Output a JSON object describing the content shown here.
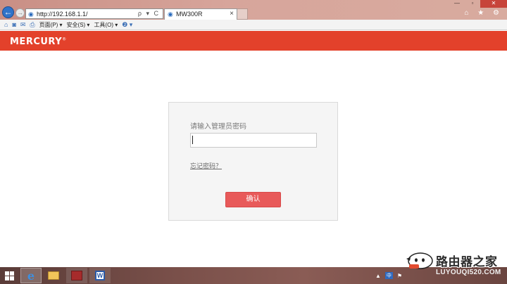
{
  "browser": {
    "address_url": "http://192.168.1.1/",
    "address_controls": "ρ ▾ C",
    "tab_title": "MW300R",
    "tab_close": "×",
    "window_controls": [
      "—",
      "▫",
      "✕"
    ],
    "toolbar_icons": "⌂ ★ ⚙"
  },
  "commandbar": {
    "items": [
      {
        "icon": "home-icon",
        "glyph": "⌂"
      },
      {
        "icon": "feeds-icon",
        "glyph": "◙"
      },
      {
        "icon": "mail-icon",
        "glyph": "✉"
      },
      {
        "icon": "print-icon",
        "glyph": "⎙"
      }
    ],
    "page_menu": "页面(P) ▾",
    "safety_menu": "安全(S) ▾",
    "tools_menu": "工具(O) ▾",
    "help_menu": "❷ ▾"
  },
  "router": {
    "brand": "MERCURY",
    "brand_mark": "®",
    "login": {
      "prompt": "请输入管理员密码",
      "password_value": "",
      "forgot_link": "忘记密码？",
      "confirm_button": "确认"
    },
    "accent_color": "#e3412b",
    "button_color": "#e85a5a"
  },
  "taskbar": {
    "apps": [
      {
        "name": "start-button",
        "icon": "windows-logo-icon"
      },
      {
        "name": "internet-explorer",
        "icon": "ie-icon",
        "glyph": "e"
      },
      {
        "name": "file-explorer",
        "icon": "folder-icon"
      },
      {
        "name": "app-red",
        "icon": "red-app-icon"
      },
      {
        "name": "word",
        "icon": "word-icon",
        "glyph": "W"
      }
    ],
    "tray": {
      "arrow": "▲",
      "ime": "中",
      "flag": "⚑"
    }
  },
  "watermark": {
    "cn": "路由器之家",
    "en": "LUYOUQI520.COM"
  }
}
